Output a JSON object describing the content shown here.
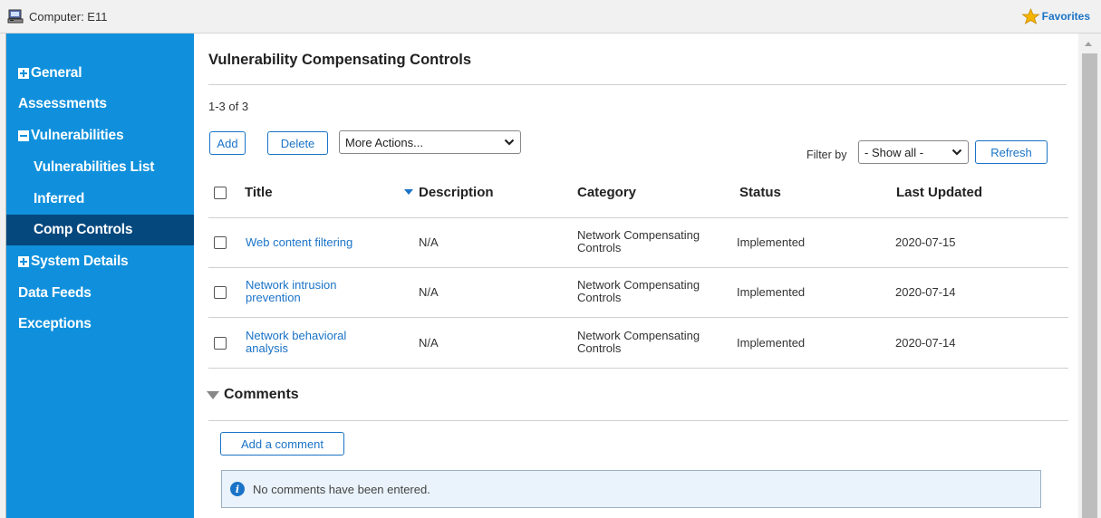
{
  "window": {
    "title": "Computer: E11",
    "favorites_label": "Favorites"
  },
  "sidebar": {
    "items": [
      {
        "label": "General",
        "expander": "plus"
      },
      {
        "label": "Assessments"
      },
      {
        "label": "Vulnerabilities",
        "expander": "minus"
      },
      {
        "label": "Vulnerabilities List"
      },
      {
        "label": "Inferred"
      },
      {
        "label": "Comp Controls",
        "active": true
      },
      {
        "label": "System Details",
        "expander": "plus"
      },
      {
        "label": "Data Feeds"
      },
      {
        "label": "Exceptions"
      }
    ]
  },
  "main": {
    "title": "Vulnerability Compensating Controls",
    "count": "1-3 of 3",
    "toolbar": {
      "add_label": "Add",
      "delete_label": "Delete",
      "more_actions_value": "More Actions...",
      "filter_label": "Filter by",
      "filter_value": "- Show all -",
      "refresh_label": "Refresh"
    },
    "table": {
      "columns": [
        "Title",
        "Description",
        "Category",
        "Status",
        "Last Updated"
      ],
      "sorted_column": "Description",
      "rows": [
        {
          "title_line1": "Web content filtering",
          "title_line2": "",
          "description": "N/A",
          "category_line1": "Network Compensating",
          "category_line2": "Controls",
          "status": "Implemented",
          "last_updated": "2020-07-15"
        },
        {
          "title_line1": "Network intrusion",
          "title_line2": "prevention",
          "description": "N/A",
          "category_line1": "Network Compensating",
          "category_line2": "Controls",
          "status": "Implemented",
          "last_updated": "2020-07-14"
        },
        {
          "title_line1": "Network behavioral",
          "title_line2": "analysis",
          "description": "N/A",
          "category_line1": "Network Compensating",
          "category_line2": "Controls",
          "status": "Implemented",
          "last_updated": "2020-07-14"
        }
      ]
    },
    "comments": {
      "heading": "Comments",
      "add_label": "Add a comment",
      "empty_message": "No comments have been entered."
    }
  },
  "colors": {
    "sidebar": "#1090dc",
    "sidebar_active": "#05487e",
    "link": "#1a73c7"
  }
}
